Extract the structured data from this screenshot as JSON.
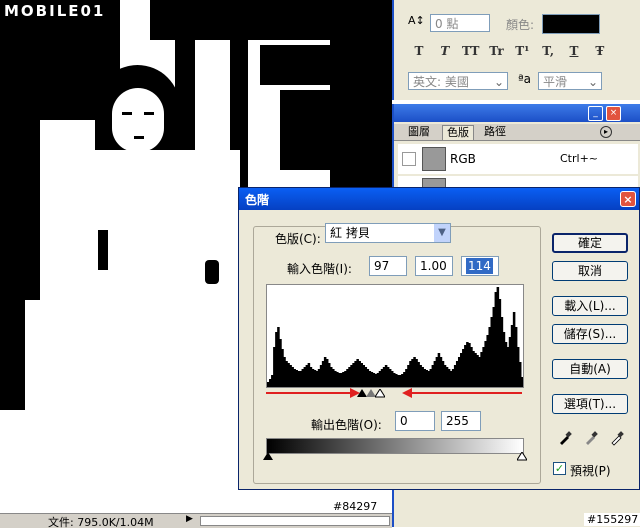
{
  "watermark": {
    "text": "MOBILE01"
  },
  "char_panel": {
    "size_field": "0 點",
    "color_label": "顏色:",
    "style_buttons": [
      "T",
      "T",
      "TT",
      "Tr",
      "T¹",
      "T,",
      "T",
      "Ŧ"
    ],
    "font_lang": "英文: 美國",
    "aa_icon": "a",
    "aa_mode": "平滑"
  },
  "layers_panel": {
    "tabs": [
      "圖層",
      "色版",
      "路徑"
    ],
    "active_tab": "色版",
    "rgb_label": "RGB",
    "rgb_shortcut": "Ctrl+~"
  },
  "levels": {
    "title": "色階",
    "channel_label": "色版(C):",
    "channel_value": "紅 拷貝",
    "input_label": "輸入色階(I):",
    "input_values": [
      "97",
      "1.00",
      "114"
    ],
    "output_label": "輸出色階(O):",
    "output_values": [
      "0",
      "255"
    ],
    "buttons": [
      "確定",
      "取消",
      "載入(L)...",
      "儲存(S)...",
      "自動(A)",
      "選項(T)..."
    ],
    "preview_label": "預視(P)",
    "preview_checked": true
  },
  "histogram_heights": [
    5,
    8,
    12,
    40,
    55,
    60,
    48,
    38,
    30,
    26,
    24,
    22,
    20,
    18,
    17,
    16,
    16,
    18,
    20,
    22,
    24,
    20,
    18,
    17,
    16,
    18,
    22,
    26,
    30,
    28,
    24,
    20,
    18,
    16,
    15,
    14,
    14,
    15,
    16,
    18,
    20,
    22,
    24,
    26,
    28,
    26,
    24,
    22,
    20,
    18,
    16,
    15,
    14,
    13,
    14,
    16,
    18,
    20,
    22,
    20,
    18,
    16,
    14,
    13,
    12,
    12,
    13,
    15,
    18,
    22,
    26,
    28,
    30,
    28,
    25,
    22,
    20,
    18,
    17,
    16,
    18,
    22,
    26,
    30,
    34,
    30,
    26,
    22,
    20,
    18,
    16,
    18,
    22,
    26,
    30,
    34,
    38,
    42,
    45,
    44,
    40,
    36,
    34,
    32,
    30,
    35,
    40,
    46,
    52,
    60,
    70,
    80,
    95,
    100,
    88,
    70,
    55,
    45,
    40,
    50,
    62,
    75,
    60,
    40,
    25,
    10
  ],
  "status": {
    "doc_info": "文件: 795.0K/1.04M"
  },
  "tags": {
    "left_id": "#84297",
    "right_id": "#155297"
  }
}
